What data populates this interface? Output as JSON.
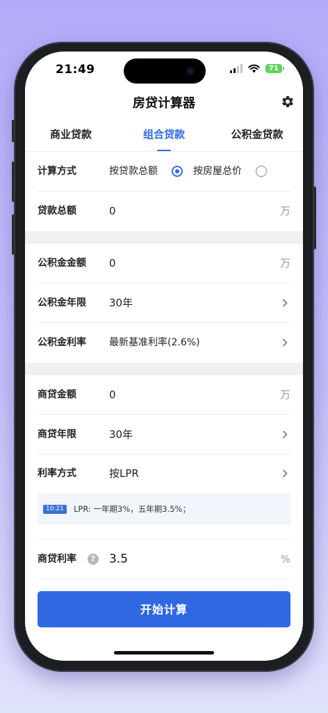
{
  "status": {
    "time": "21:49",
    "battery": "71"
  },
  "header": {
    "title": "房贷计算器"
  },
  "tabs": [
    {
      "label": "商业贷款",
      "active": false
    },
    {
      "label": "组合贷款",
      "active": true
    },
    {
      "label": "公积金贷款",
      "active": false
    }
  ],
  "calc_method": {
    "label": "计算方式",
    "option1": "按贷款总额",
    "option1_selected": true,
    "option2": "按房屋总价",
    "option2_selected": false
  },
  "loan_total": {
    "label": "贷款总额",
    "value": "0",
    "unit": "万"
  },
  "fund": {
    "amount": {
      "label": "公积金金额",
      "value": "0",
      "unit": "万"
    },
    "term": {
      "label": "公积金年限",
      "value": "30年"
    },
    "rate": {
      "label": "公积金利率",
      "value": "最新基准利率(2.6%)"
    }
  },
  "commercial": {
    "amount": {
      "label": "商贷金额",
      "value": "0",
      "unit": "万"
    },
    "term": {
      "label": "商贷年限",
      "value": "30年"
    },
    "rate_method": {
      "label": "利率方式",
      "value": "按LPR"
    },
    "tip": {
      "badge": "10:21",
      "text": "LPR: 一年期3%，五年期3.5%；"
    },
    "rate": {
      "label": "商贷利率",
      "help": "?",
      "value": "3.5",
      "unit": "%"
    }
  },
  "action": {
    "label": "开始计算"
  },
  "colors": {
    "accent": "#2f6ae5",
    "button": "#3068e4",
    "battery": "#5fd35a"
  }
}
